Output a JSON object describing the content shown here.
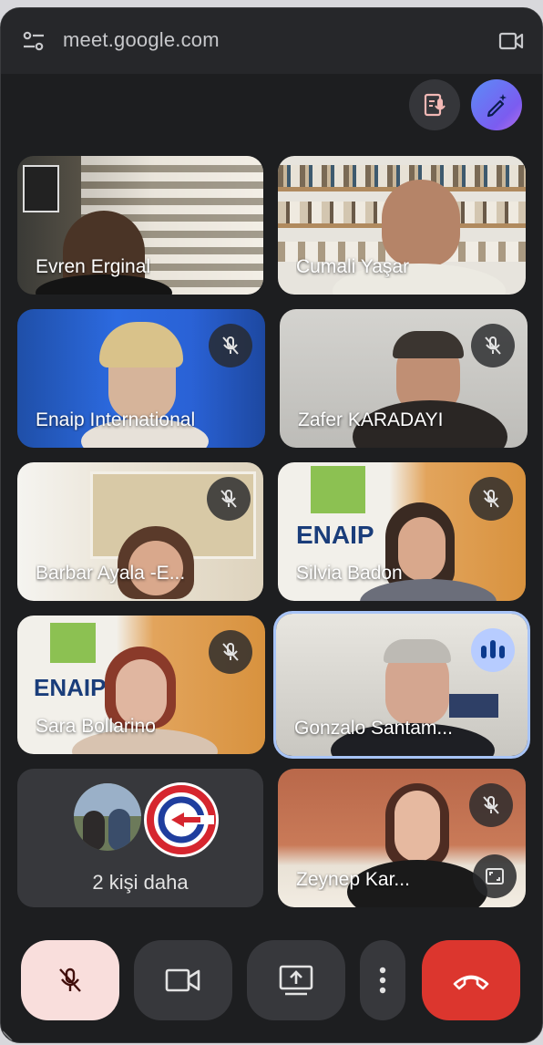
{
  "browser": {
    "url": "meet.google.com",
    "address_icon": "tune-icon",
    "camera_icon": "video-camera-icon"
  },
  "top_actions": [
    {
      "name": "notes",
      "icon": "transcript-notes-icon"
    },
    {
      "name": "effects",
      "icon": "sparkle-pen-icon"
    }
  ],
  "participants": [
    {
      "name": "Evren Erginal",
      "muted": false
    },
    {
      "name": "Cumali Yaşar",
      "muted": false
    },
    {
      "name": "Enaip International",
      "muted": true
    },
    {
      "name": "Zafer KARADAYI",
      "muted": true
    },
    {
      "name": "Barbar Ayala -E...",
      "muted": true
    },
    {
      "name": "Silvia Badon",
      "muted": true
    },
    {
      "name": "Sara Bollarino",
      "muted": true
    },
    {
      "name": "Gonzalo Santam...",
      "muted": false,
      "speaking": true
    },
    {
      "name": "Zeynep Kar...",
      "muted": true
    }
  ],
  "overflow": {
    "label": "2 kişi daha"
  },
  "controls": {
    "mic": {
      "icon": "mic-off-icon",
      "state": "muted",
      "color": "#f9dedc"
    },
    "camera": {
      "icon": "video-camera-icon"
    },
    "share": {
      "icon": "present-screen-icon"
    },
    "options": {
      "icon": "more-vert-icon"
    },
    "end": {
      "icon": "call-end-icon",
      "color": "#dc362e"
    }
  },
  "colors": {
    "accent": "#a8c4f7",
    "window": "#1d1e20"
  }
}
